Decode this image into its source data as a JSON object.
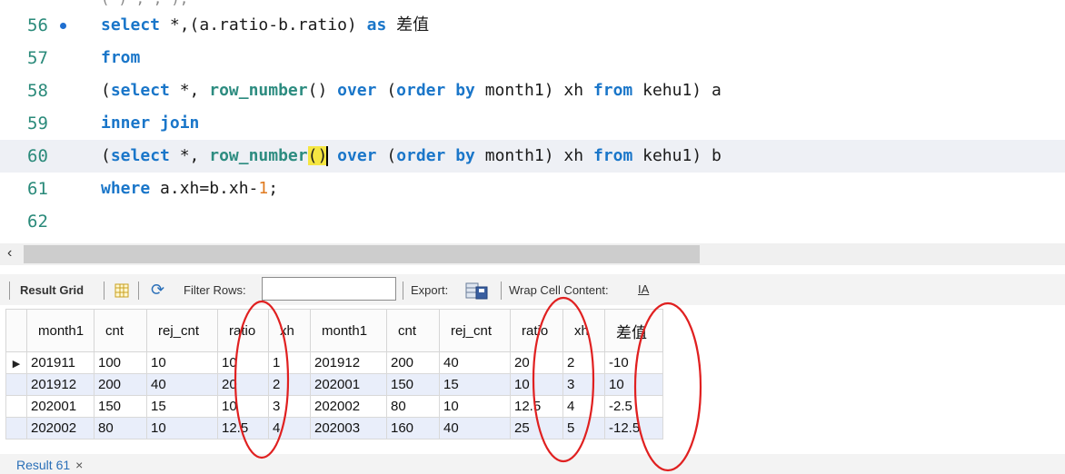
{
  "editor": {
    "lines": [
      {
        "num": "56",
        "parts": [
          [
            "kw",
            "select"
          ],
          [
            "t",
            " *,(a.ratio-b.ratio) "
          ],
          [
            "kw",
            "as"
          ],
          [
            "t",
            " 差值"
          ]
        ]
      },
      {
        "num": "57",
        "parts": [
          [
            "kw",
            "from"
          ]
        ]
      },
      {
        "num": "58",
        "parts": [
          [
            "t",
            "("
          ],
          [
            "kw",
            "select"
          ],
          [
            "t",
            " *, "
          ],
          [
            "fn",
            "row_number"
          ],
          [
            "t",
            "() "
          ],
          [
            "kw",
            "over"
          ],
          [
            "t",
            " ("
          ],
          [
            "kw",
            "order by"
          ],
          [
            "t",
            " month1) xh "
          ],
          [
            "kw",
            "from"
          ],
          [
            "t",
            " kehu1) a"
          ]
        ]
      },
      {
        "num": "59",
        "parts": [
          [
            "kw",
            "inner join"
          ]
        ]
      },
      {
        "num": "60",
        "parts": [
          [
            "t",
            "("
          ],
          [
            "kw",
            "select"
          ],
          [
            "t",
            " *, "
          ],
          [
            "fn",
            "row_number"
          ],
          [
            "hl",
            "()"
          ],
          [
            "caret",
            ""
          ],
          [
            "t",
            " "
          ],
          [
            "kw",
            "over"
          ],
          [
            "t",
            " ("
          ],
          [
            "kw",
            "order by"
          ],
          [
            "t",
            " month1) xh "
          ],
          [
            "kw",
            "from"
          ],
          [
            "t",
            " kehu1) b"
          ]
        ]
      },
      {
        "num": "61",
        "parts": [
          [
            "kw",
            "where"
          ],
          [
            "t",
            " a.xh=b.xh-"
          ],
          [
            "num",
            "1"
          ],
          [
            "t",
            ";"
          ]
        ]
      },
      {
        "num": "62",
        "parts": []
      }
    ]
  },
  "toolbar": {
    "result_grid": "Result Grid",
    "filter_rows": "Filter Rows:",
    "export": "Export:",
    "wrap": "Wrap Cell Content:",
    "wrap_icon": "IA"
  },
  "grid": {
    "columns": [
      "month1",
      "cnt",
      "rej_cnt",
      "ratio",
      "xh",
      "month1",
      "cnt",
      "rej_cnt",
      "ratio",
      "xh",
      "差值"
    ],
    "rows": [
      [
        "201911",
        "100",
        "10",
        "10",
        "1",
        "201912",
        "200",
        "40",
        "20",
        "2",
        "-10"
      ],
      [
        "201912",
        "200",
        "40",
        "20",
        "2",
        "202001",
        "150",
        "15",
        "10",
        "3",
        "10"
      ],
      [
        "202001",
        "150",
        "15",
        "10",
        "3",
        "202002",
        "80",
        "10",
        "12.5",
        "4",
        "-2.5"
      ],
      [
        "202002",
        "80",
        "10",
        "12.5",
        "4",
        "202003",
        "160",
        "40",
        "25",
        "5",
        "-12.5"
      ]
    ]
  },
  "tabs": {
    "result_tab": "Result 61",
    "close": "×"
  },
  "colors": {
    "keyword": "#1a76c9",
    "function": "#2d8c80",
    "number": "#e07a1f",
    "annotation": "#e02020"
  }
}
